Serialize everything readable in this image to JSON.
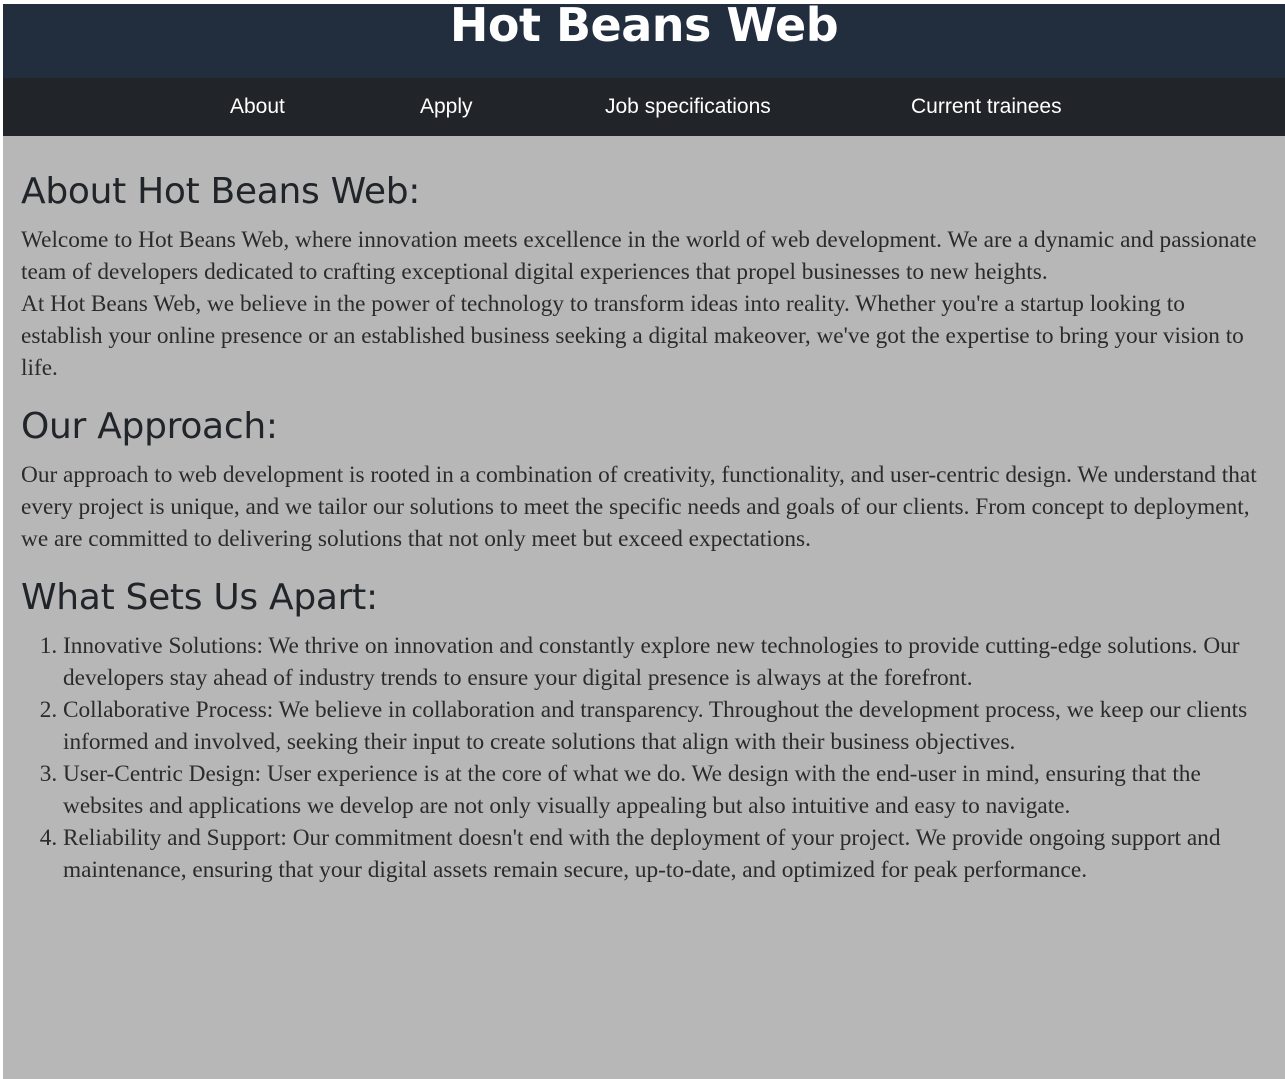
{
  "header": {
    "title": "Hot Beans Web"
  },
  "nav": {
    "items": [
      {
        "label": "About"
      },
      {
        "label": "Apply"
      },
      {
        "label": "Job specifications"
      },
      {
        "label": "Current trainees"
      }
    ]
  },
  "sections": {
    "about": {
      "heading": "About Hot Beans Web:",
      "paragraphs": [
        "Welcome to Hot Beans Web, where innovation meets excellence in the world of web development. We are a dynamic and passionate team of developers dedicated to crafting exceptional digital experiences that propel businesses to new heights.",
        "At Hot Beans Web, we believe in the power of technology to transform ideas into reality. Whether you're a startup looking to establish your online presence or an established business seeking a digital makeover, we've got the expertise to bring your vision to life."
      ]
    },
    "approach": {
      "heading": "Our Approach:",
      "paragraph": "Our approach to web development is rooted in a combination of creativity, functionality, and user-centric design. We understand that every project is unique, and we tailor our solutions to meet the specific needs and goals of our clients. From concept to deployment, we are committed to delivering solutions that not only meet but exceed expectations."
    },
    "apart": {
      "heading": "What Sets Us Apart:",
      "items": [
        "Innovative Solutions: We thrive on innovation and constantly explore new technologies to provide cutting-edge solutions. Our developers stay ahead of industry trends to ensure your digital presence is always at the forefront.",
        "Collaborative Process: We believe in collaboration and transparency. Throughout the development process, we keep our clients informed and involved, seeking their input to create solutions that align with their business objectives.",
        "User-Centric Design: User experience is at the core of what we do. We design with the end-user in mind, ensuring that the websites and applications we develop are not only visually appealing but also intuitive and easy to navigate.",
        "Reliability and Support: Our commitment doesn't end with the deployment of your project. We provide ongoing support and maintenance, ensuring that your digital assets remain secure, up-to-date, and optimized for peak performance."
      ]
    }
  },
  "colors": {
    "header_bg": "#222d3e",
    "nav_bg": "#212428",
    "page_bg": "#b7b7b7",
    "heading_text": "#212428",
    "body_text": "#2b2b2b"
  }
}
